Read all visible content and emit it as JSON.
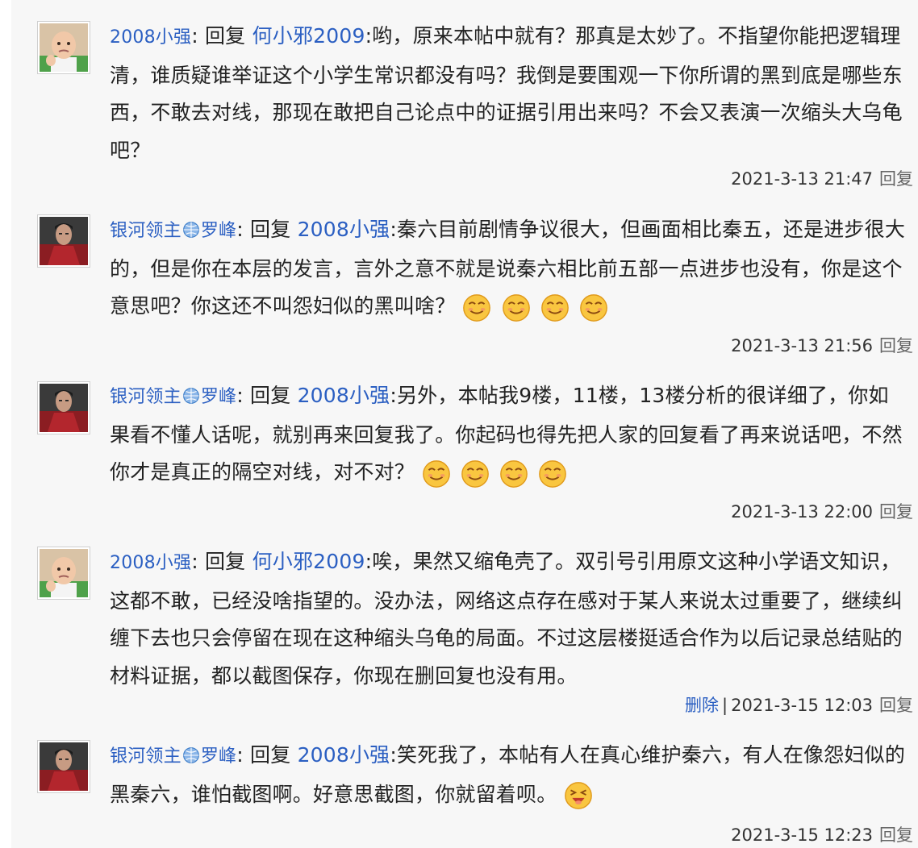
{
  "colors": {
    "link": "#2b5fc2",
    "background": "#f7f7f7"
  },
  "posts": [
    {
      "user": "2008小强",
      "colon": ":",
      "reply_word": "回复",
      "target": "何小邪2009",
      "text": ":哟，原来本帖中就有？那真是太妙了。不指望你能把逻辑理清，谁质疑谁举证这个小学生常识都没有吗？我倒是要围观一下你所谓的黑到底是哪些东西，不敢去对线，那现在敢把自己论点中的证据引用出来吗？不会又表演一次缩头大乌龟吧？",
      "time": "2021-3-13 21:47",
      "reply_link": "回复",
      "avatar_icon": "baby-avatar"
    },
    {
      "user_part1": "银河领主",
      "user_part2": "罗峰",
      "colon": ":",
      "reply_word": "回复",
      "target": "2008小强",
      "text": ":秦六目前剧情争议很大，但画面相比秦五，还是进步很大的，但是你在本层的发言，言外之意不就是说秦六相比前五部一点进步也没有，你是这个意思吧？你这还不叫怨妇似的黑叫啥？",
      "emoji_count": 4,
      "emoji_icon": "smug-face-emoji",
      "time": "2021-3-13 21:56",
      "reply_link": "回复",
      "avatar_icon": "armored-character-avatar"
    },
    {
      "user_part1": "银河领主",
      "user_part2": "罗峰",
      "colon": ":",
      "reply_word": "回复",
      "target": "2008小强",
      "text": ":另外，本帖我9楼，11楼，13楼分析的很详细了，你如果看不懂人话呢，就别再来回复我了。你起码也得先把人家的回复看了再来说话吧，不然你才是真正的隔空对线，对不对？",
      "emoji_count": 4,
      "emoji_icon": "smug-face-emoji",
      "time": "2021-3-13 22:00",
      "reply_link": "回复",
      "avatar_icon": "armored-character-avatar"
    },
    {
      "user": "2008小强",
      "colon": ":",
      "reply_word": "回复",
      "target": "何小邪2009",
      "text": ":唉，果然又缩龟壳了。双引号引用原文这种小学语文知识，这都不敢，已经没啥指望的。没办法，网络这点存在感对于某人来说太过重要了，继续纠缠下去也只会停留在现在这种缩头乌龟的局面。不过这层楼挺适合作为以后记录总结贴的材料证据，都以截图保存，你现在删回复也没有用。",
      "delete_link": "删除",
      "separator": "|",
      "time": "2021-3-15 12:03",
      "reply_link": "回复",
      "avatar_icon": "baby-avatar"
    },
    {
      "user_part1": "银河领主",
      "user_part2": "罗峰",
      "colon": ":",
      "reply_word": "回复",
      "target": "2008小强",
      "text": ":笑死我了，本帖有人在真心维护秦六，有人在像怨妇似的黑秦六，谁怕截图啊。好意思截图，你就留着呗。",
      "emoji_count": 1,
      "emoji_icon": "laughing-face-emoji",
      "time": "2021-3-15 12:23",
      "reply_link": "回复",
      "avatar_icon": "armored-character-avatar"
    }
  ]
}
